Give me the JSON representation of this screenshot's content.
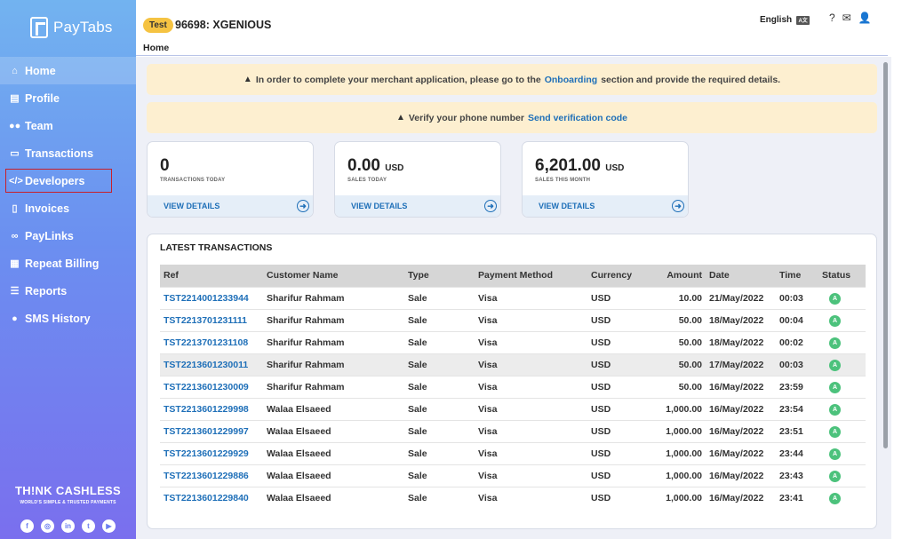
{
  "brand": {
    "name": "PayTabs"
  },
  "sidebar": {
    "items": [
      {
        "label": "Home",
        "icon": "home-icon"
      },
      {
        "label": "Profile",
        "icon": "bank-icon"
      },
      {
        "label": "Team",
        "icon": "team-icon"
      },
      {
        "label": "Transactions",
        "icon": "transactions-icon"
      },
      {
        "label": "Developers",
        "icon": "code-icon"
      },
      {
        "label": "Invoices",
        "icon": "invoice-icon"
      },
      {
        "label": "PayLinks",
        "icon": "link-icon"
      },
      {
        "label": "Repeat Billing",
        "icon": "calendar-icon"
      },
      {
        "label": "Reports",
        "icon": "reports-icon"
      },
      {
        "label": "SMS History",
        "icon": "chat-icon"
      }
    ],
    "tagline": "TH!NK CASHLESS",
    "tagline_sub": "WORLD'S SIMPLE & TRUSTED PAYMENTS",
    "socials": [
      "facebook-icon",
      "instagram-icon",
      "linkedin-icon",
      "twitter-icon",
      "youtube-icon"
    ]
  },
  "header": {
    "badge": "Test",
    "merchant": "96698: XGENIOUS",
    "breadcrumb": "Home",
    "language": "English"
  },
  "alerts": {
    "onboarding_prefix": "In order to complete your merchant application, please go to the",
    "onboarding_link": "Onboarding",
    "onboarding_suffix": "section and provide the required details.",
    "phone_prefix": "Verify your phone number",
    "phone_link": "Send verification code"
  },
  "stats": [
    {
      "value": "0",
      "currency": "",
      "label": "TRANSACTIONS TODAY",
      "action": "VIEW DETAILS"
    },
    {
      "value": "0.00",
      "currency": "USD",
      "label": "SALES TODAY",
      "action": "VIEW DETAILS"
    },
    {
      "value": "6,201.00",
      "currency": "USD",
      "label": "SALES THIS MONTH",
      "action": "VIEW DETAILS"
    }
  ],
  "latest": {
    "title": "LATEST TRANSACTIONS",
    "columns": [
      "Ref",
      "Customer Name",
      "Type",
      "Payment Method",
      "Currency",
      "Amount",
      "Date",
      "Time",
      "Status"
    ],
    "rows": [
      {
        "ref": "TST2214001233944",
        "customer": "Sharifur Rahmam",
        "type": "Sale",
        "method": "Visa",
        "currency": "USD",
        "amount": "10.00",
        "date": "21/May/2022",
        "time": "00:03",
        "status": "A"
      },
      {
        "ref": "TST2213701231111",
        "customer": "Sharifur Rahmam",
        "type": "Sale",
        "method": "Visa",
        "currency": "USD",
        "amount": "50.00",
        "date": "18/May/2022",
        "time": "00:04",
        "status": "A"
      },
      {
        "ref": "TST2213701231108",
        "customer": "Sharifur Rahmam",
        "type": "Sale",
        "method": "Visa",
        "currency": "USD",
        "amount": "50.00",
        "date": "18/May/2022",
        "time": "00:02",
        "status": "A"
      },
      {
        "ref": "TST2213601230011",
        "customer": "Sharifur Rahmam",
        "type": "Sale",
        "method": "Visa",
        "currency": "USD",
        "amount": "50.00",
        "date": "17/May/2022",
        "time": "00:03",
        "status": "A"
      },
      {
        "ref": "TST2213601230009",
        "customer": "Sharifur Rahmam",
        "type": "Sale",
        "method": "Visa",
        "currency": "USD",
        "amount": "50.00",
        "date": "16/May/2022",
        "time": "23:59",
        "status": "A"
      },
      {
        "ref": "TST2213601229998",
        "customer": "Walaa Elsaeed",
        "type": "Sale",
        "method": "Visa",
        "currency": "USD",
        "amount": "1,000.00",
        "date": "16/May/2022",
        "time": "23:54",
        "status": "A"
      },
      {
        "ref": "TST2213601229997",
        "customer": "Walaa Elsaeed",
        "type": "Sale",
        "method": "Visa",
        "currency": "USD",
        "amount": "1,000.00",
        "date": "16/May/2022",
        "time": "23:51",
        "status": "A"
      },
      {
        "ref": "TST2213601229929",
        "customer": "Walaa Elsaeed",
        "type": "Sale",
        "method": "Visa",
        "currency": "USD",
        "amount": "1,000.00",
        "date": "16/May/2022",
        "time": "23:44",
        "status": "A"
      },
      {
        "ref": "TST2213601229886",
        "customer": "Walaa Elsaeed",
        "type": "Sale",
        "method": "Visa",
        "currency": "USD",
        "amount": "1,000.00",
        "date": "16/May/2022",
        "time": "23:43",
        "status": "A"
      },
      {
        "ref": "TST2213601229840",
        "customer": "Walaa Elsaeed",
        "type": "Sale",
        "method": "Visa",
        "currency": "USD",
        "amount": "1,000.00",
        "date": "16/May/2022",
        "time": "23:41",
        "status": "A"
      }
    ]
  },
  "colors": {
    "accent": "#1e6fb8",
    "badge": "#f5c342",
    "status_ok": "#4cc27c",
    "alert_bg": "#fdefd0"
  }
}
